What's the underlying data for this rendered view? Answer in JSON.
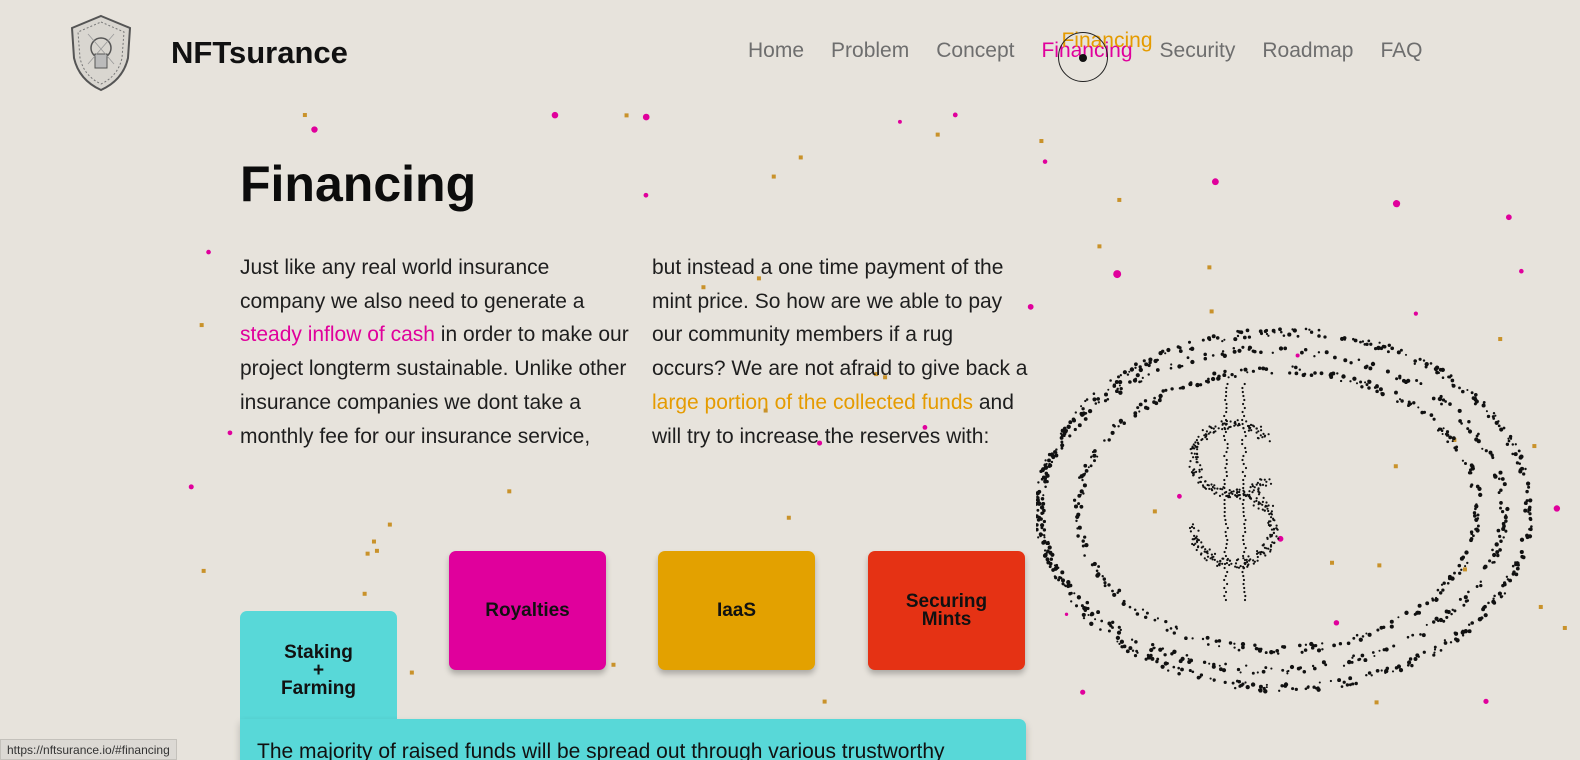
{
  "brand": {
    "name": "NFTsurance",
    "logo": "shield-logo"
  },
  "nav": {
    "items": [
      "Home",
      "Problem",
      "Concept",
      "Financing",
      "Security",
      "Roadmap",
      "FAQ"
    ],
    "active": "Financing"
  },
  "section": {
    "title": "Financing",
    "left_text": {
      "p1": "Just like any real world insurance company we also need to generate a ",
      "highlight": "steady inflow of cash",
      "p2": " in order to make our project longterm sustainable. Unlike other insurance companies we dont take a monthly fee for our insurance service,"
    },
    "right_text": {
      "p1": "but instead a one time payment of the mint price. So how are we able to pay our community members if a rug occurs? We are not afraid to give back a ",
      "highlight": "large portion of the collected funds",
      "p2": " and will try to increase the reserves with:"
    }
  },
  "cards": {
    "royalties": "Royalties",
    "iaas": "IaaS",
    "mints_line1": "Securing",
    "mints_line2": "Mints",
    "staking_line1": "Staking",
    "staking_line2": "+",
    "staking_line3": "Farming"
  },
  "panel_text": "The majority of raised funds will be spread out through various trustworthy",
  "status_bar_url": "https://nftsurance.io/#financing",
  "colors": {
    "background": "#e7e3dc",
    "pink": "#e0009c",
    "orange": "#e59b00",
    "red": "#e53214",
    "cyan": "#58d8d8"
  },
  "icons": [
    "shield-logo-icon",
    "dollar-coin-icon",
    "lock-particle-icon",
    "heart-particle-icon"
  ]
}
